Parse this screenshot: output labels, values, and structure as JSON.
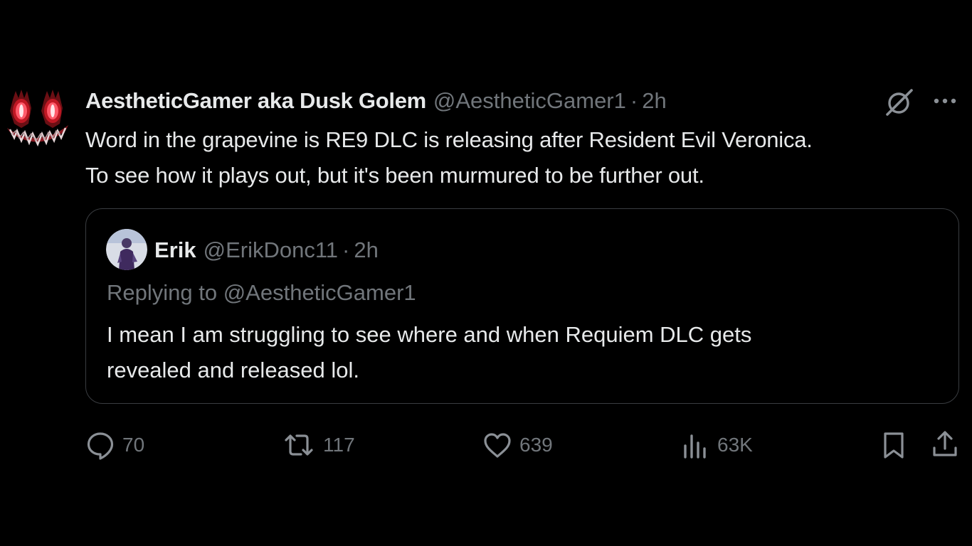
{
  "tweet": {
    "author_name": "AestheticGamer aka Dusk Golem",
    "author_handle": "@AestheticGamer1",
    "separator": "·",
    "time": "2h",
    "text_lines": [
      "Word in the grapevine is RE9 DLC is releasing after Resident Evil Veronica.",
      "To see how it plays out, but it's been murmured to be further out."
    ],
    "icons": {
      "avatar": "monster-avatar",
      "grok": "grok-icon",
      "more": "more-icon"
    }
  },
  "quote": {
    "author_name": "Erik",
    "author_handle": "@ErikDonc11",
    "separator": "·",
    "time": "2h",
    "replying_to": "Replying to @AestheticGamer1",
    "text_lines": [
      "I mean I am struggling to see where and when Requiem DLC gets",
      "revealed and released lol."
    ]
  },
  "actions": {
    "replies": "70",
    "reposts": "117",
    "likes": "639",
    "views": "63K",
    "icons": [
      "reply-icon",
      "retweet-icon",
      "heart-icon",
      "views-icon",
      "bookmark-icon",
      "share-icon"
    ]
  },
  "colors": {
    "background": "#000000",
    "primary_text": "#e7e9ea",
    "secondary_text": "#71767b",
    "border": "#3a3d41",
    "avatar_accent": "#d0202a"
  }
}
